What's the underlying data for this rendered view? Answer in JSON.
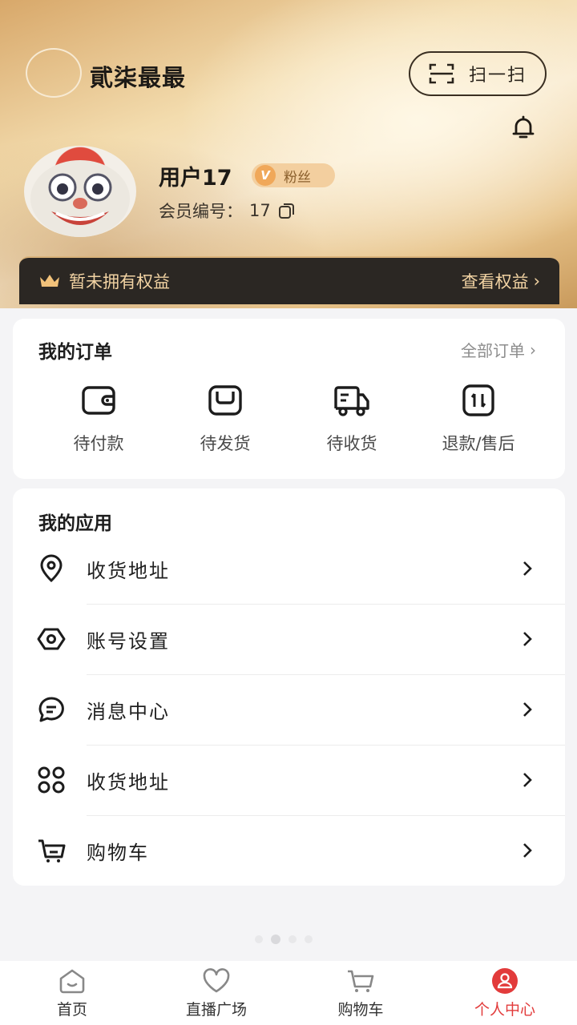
{
  "header": {
    "brand_name": "貮柒最最",
    "scan_label": "扫一扫",
    "user": {
      "name": "用户17",
      "badge_letter": "V",
      "badge_label": "粉丝",
      "member_no_label": "会员编号：",
      "member_no": "17"
    },
    "benefits": {
      "status": "暂未拥有权益",
      "link": "查看权益",
      "link_arrow": "›"
    }
  },
  "orders": {
    "title": "我的订单",
    "all_label": "全部订单",
    "all_arrow": "›",
    "items": [
      {
        "label": "待付款",
        "icon": "wallet-icon"
      },
      {
        "label": "待发货",
        "icon": "package-icon"
      },
      {
        "label": "待收货",
        "icon": "truck-icon"
      },
      {
        "label": "退款/售后",
        "icon": "refund-icon"
      }
    ]
  },
  "apps": {
    "title": "我的应用",
    "items": [
      {
        "label": "收货地址",
        "icon": "location-pin-icon"
      },
      {
        "label": "账号设置",
        "icon": "settings-hexagon-icon"
      },
      {
        "label": "消息中心",
        "icon": "message-bubble-icon"
      },
      {
        "label": "收货地址",
        "icon": "grid-apps-icon"
      },
      {
        "label": "购物车",
        "icon": "cart-icon"
      }
    ]
  },
  "tabbar": {
    "items": [
      {
        "label": "首页",
        "icon": "home-icon",
        "active": false
      },
      {
        "label": "直播广场",
        "icon": "heart-icon",
        "active": false
      },
      {
        "label": "购物车",
        "icon": "cart-icon",
        "active": false
      },
      {
        "label": "个人中心",
        "icon": "profile-icon",
        "active": true
      }
    ]
  },
  "colors": {
    "accent_red": "#e23b3b",
    "gold": "#f2d3a3",
    "benefit_bar": "#2b2723"
  }
}
